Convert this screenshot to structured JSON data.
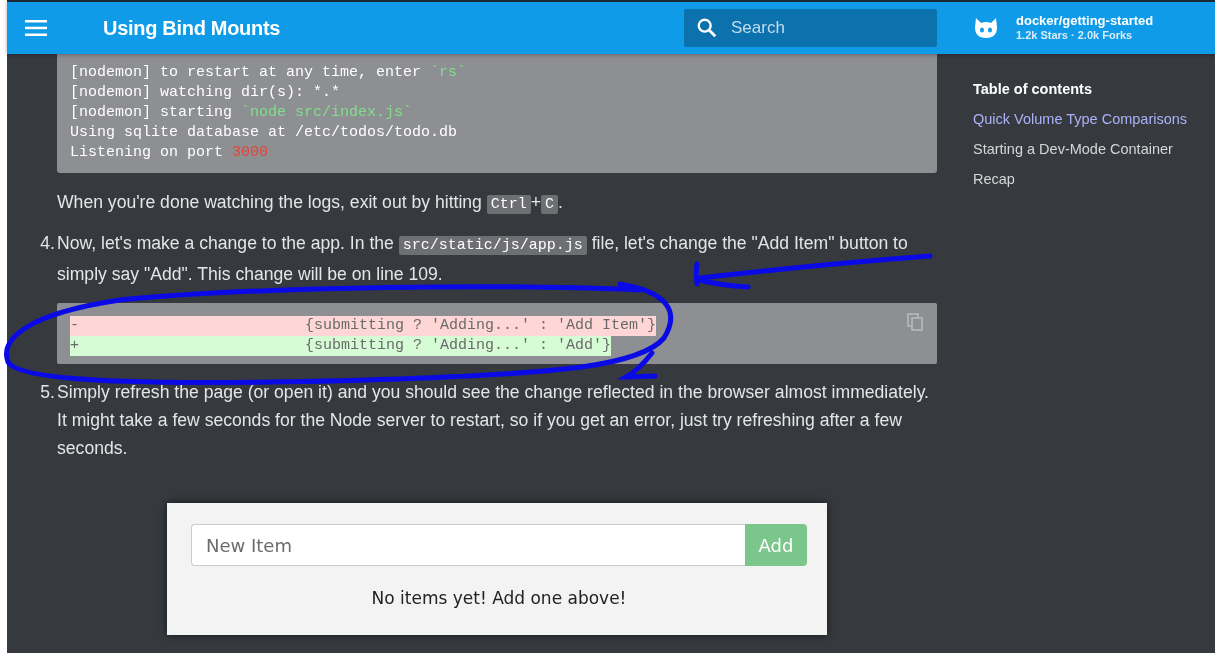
{
  "header": {
    "title": "Using Bind Mounts",
    "search": {
      "placeholder": "Search"
    },
    "repo": {
      "name": "docker/getting-started",
      "stats": "1.2k Stars · 2.0k Forks"
    }
  },
  "log_block": {
    "lines": [
      {
        "parts": [
          {
            "text": "[nodemon] to restart at any time, enter ",
            "kind": "plain"
          },
          {
            "text": "`rs`",
            "kind": "string"
          }
        ]
      },
      {
        "parts": [
          {
            "text": "[nodemon] watching dir(s): *.*",
            "kind": "plain"
          }
        ]
      },
      {
        "parts": [
          {
            "text": "[nodemon] starting ",
            "kind": "plain"
          },
          {
            "text": "`node src/index.js`",
            "kind": "string"
          }
        ]
      },
      {
        "parts": [
          {
            "text": "Using sqlite database at /etc/todos/todo.db",
            "kind": "plain"
          }
        ]
      },
      {
        "parts": [
          {
            "text": "Listening on port ",
            "kind": "plain"
          },
          {
            "text": "3000",
            "kind": "number"
          }
        ]
      }
    ]
  },
  "note": [
    {
      "text": "When you're done watching the logs, exit out by hitting ",
      "kind": "text"
    },
    {
      "text": "Ctrl",
      "kind": "code"
    },
    {
      "text": "+",
      "kind": "text"
    },
    {
      "text": "C",
      "kind": "code"
    },
    {
      "text": ".",
      "kind": "text"
    }
  ],
  "steps": [
    {
      "number": "4.",
      "parts": [
        {
          "text": "Now, let's make a change to the app. In the ",
          "kind": "text"
        },
        {
          "text": "src/static/js/app.js",
          "kind": "code"
        },
        {
          "text": " file, let's change the \"Add Item\" button to simply say \"Add\". This change will be on line 109.",
          "kind": "text"
        }
      ],
      "diff": [
        {
          "kind": "removed",
          "prefix": "-",
          "code": "{submitting ? 'Adding...' : 'Add Item'}"
        },
        {
          "kind": "added",
          "prefix": "+",
          "code": "{submitting ? 'Adding...' : 'Add'}"
        }
      ]
    },
    {
      "number": "5.",
      "parts": [
        {
          "text": "Simply refresh the page (or open it) and you should see the change reflected in the browser almost immediately. It might take a few seconds for the Node server to restart, so if you get an error, just try refreshing after a few seconds.",
          "kind": "text"
        }
      ]
    }
  ],
  "app_preview": {
    "input": {
      "placeholder": "New Item"
    },
    "button": "Add",
    "empty_message": "No items yet! Add one above!"
  },
  "toc": {
    "title": "Table of contents",
    "items": [
      {
        "label": "Quick Volume Type Comparisons",
        "selected": true
      },
      {
        "label": "Starting a Dev-Mode Container",
        "selected": false
      },
      {
        "label": "Recap",
        "selected": false
      }
    ]
  }
}
